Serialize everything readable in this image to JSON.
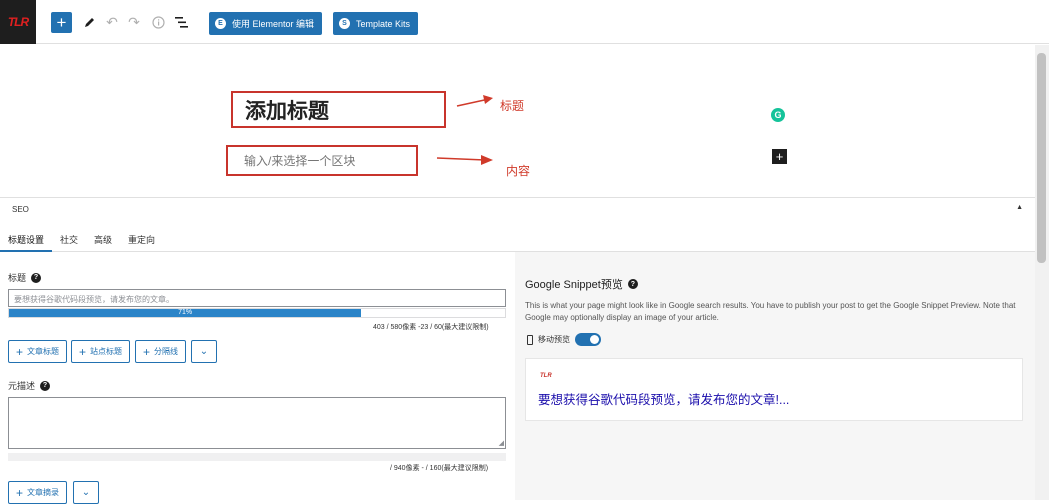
{
  "toolbar": {
    "logo_text": "TLR",
    "elementor_label": "使用 Elementor 编辑",
    "template_kits_label": "Template Kits",
    "icons": [
      "add-block-icon",
      "pencil-icon",
      "undo-icon",
      "redo-icon",
      "info-icon",
      "list-view-icon"
    ]
  },
  "editor": {
    "title_placeholder": "添加标题",
    "content_placeholder": "输入/来选择一个区块",
    "annotation_title": "标题",
    "annotation_content": "内容"
  },
  "seo": {
    "header": "SEO",
    "tabs": [
      "标题设置",
      "社交",
      "高级",
      "重定向"
    ],
    "title_label": "标题",
    "title_input_placeholder": "要想获得谷歌代码段预览，请发布您的文章。",
    "title_progress": {
      "percent": 71,
      "label": "71%"
    },
    "title_counter": "403 / 580像素 -23 / 60(最大建议限制)",
    "variable_buttons": [
      "文章标题",
      "站点标题",
      "分隔线"
    ],
    "desc_label": "元描述",
    "desc_counter": "/ 940像素 - / 160(最大建议限制)",
    "desc_buttons": [
      "文章摘录"
    ]
  },
  "snippet": {
    "title": "Google Snippet预览",
    "description": "This is what your page might look like in Google search results. You have to publish your post to get the Google Snippet Preview. Note that Google may optionally display an image of your article.",
    "mobile_label": "移动预览",
    "mobile_enabled": true,
    "preview_favicon": "TLR",
    "preview_title": "要想获得谷歌代码段预览，请发布您的文章!..."
  },
  "colors": {
    "accent": "#2271b1",
    "annotation": "#c8342c",
    "preview_link": "#1a0dab"
  }
}
